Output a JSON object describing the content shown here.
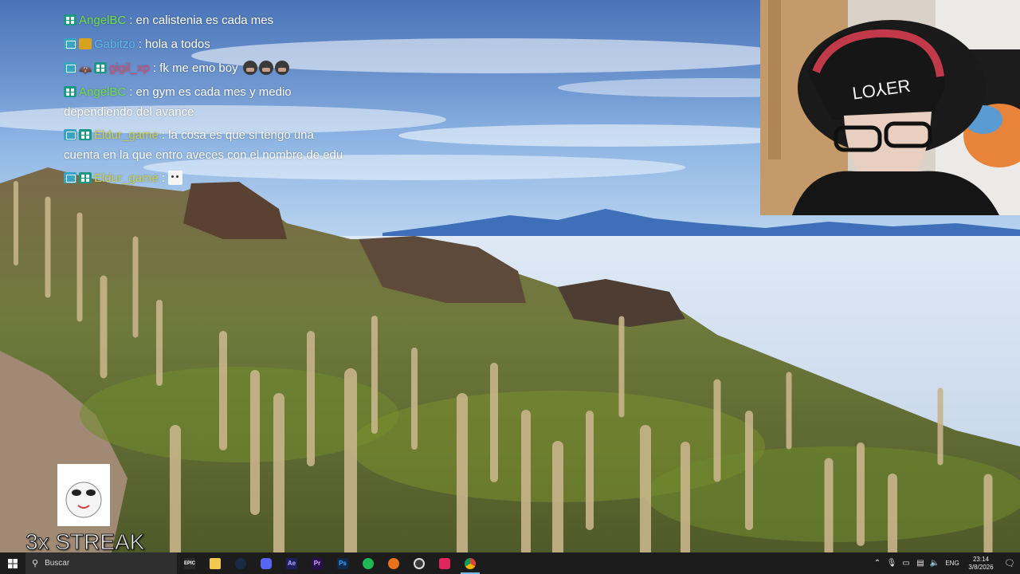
{
  "chat": {
    "messages": [
      {
        "user": "AngelBC",
        "user_color": "#6ee04c",
        "badges": [
          "sub"
        ],
        "text": ": en calistenia es cada mes",
        "cont": ""
      },
      {
        "user": "Gabitzo",
        "user_color": "#5db8f0",
        "badges": [
          "prime",
          "crown"
        ],
        "text": ": hola a todos",
        "cont": ""
      },
      {
        "user": "gigil_xp",
        "user_color": "#e04a6a",
        "badges": [
          "prime",
          "bat",
          "sub"
        ],
        "text": ": fk me emo boy",
        "cont": ""
      },
      {
        "user": "AngelBC",
        "user_color": "#6ee04c",
        "badges": [
          "sub"
        ],
        "text": ": en gym es cada mes y medio",
        "cont": "dependiendo del avance"
      },
      {
        "user": "Eldur_game",
        "user_color": "#c9d04a",
        "badges": [
          "prime",
          "sub"
        ],
        "text": ": la cosa es que si tengo una",
        "cont": "cuenta en la que entro aveces con el nombre de edu"
      },
      {
        "user": "Eldur_game",
        "user_color": "#c9d04a",
        "badges": [
          "prime",
          "sub"
        ],
        "text": ":",
        "cont": ""
      }
    ]
  },
  "streak": {
    "label": "3x STREAK"
  },
  "taskbar": {
    "search_placeholder": "Buscar",
    "apps": [
      {
        "name": "epic-games",
        "glyph": "EPIC",
        "bg": "#2a2a2a"
      },
      {
        "name": "file-explorer",
        "glyph": "",
        "bg": "#f2c94c"
      },
      {
        "name": "steam",
        "glyph": "",
        "bg": "#1b2a44"
      },
      {
        "name": "discord",
        "glyph": "",
        "bg": "#5865f2"
      },
      {
        "name": "after-effects",
        "glyph": "Ae",
        "bg": "#1f1f5e"
      },
      {
        "name": "premiere-pro",
        "glyph": "Pr",
        "bg": "#2a0f4f"
      },
      {
        "name": "photoshop",
        "glyph": "Ps",
        "bg": "#0e2a4d"
      },
      {
        "name": "spotify",
        "glyph": "",
        "bg": "#1db954"
      },
      {
        "name": "firefox",
        "glyph": "",
        "bg": "#e8731c"
      },
      {
        "name": "obs",
        "glyph": "",
        "bg": "#3a3a3a"
      },
      {
        "name": "tiktok",
        "glyph": "",
        "bg": "#e0245e"
      },
      {
        "name": "chrome",
        "glyph": "",
        "bg": "#e8a21c"
      }
    ],
    "language": "ENG",
    "time": "23:14",
    "date": "3/8/2026"
  }
}
